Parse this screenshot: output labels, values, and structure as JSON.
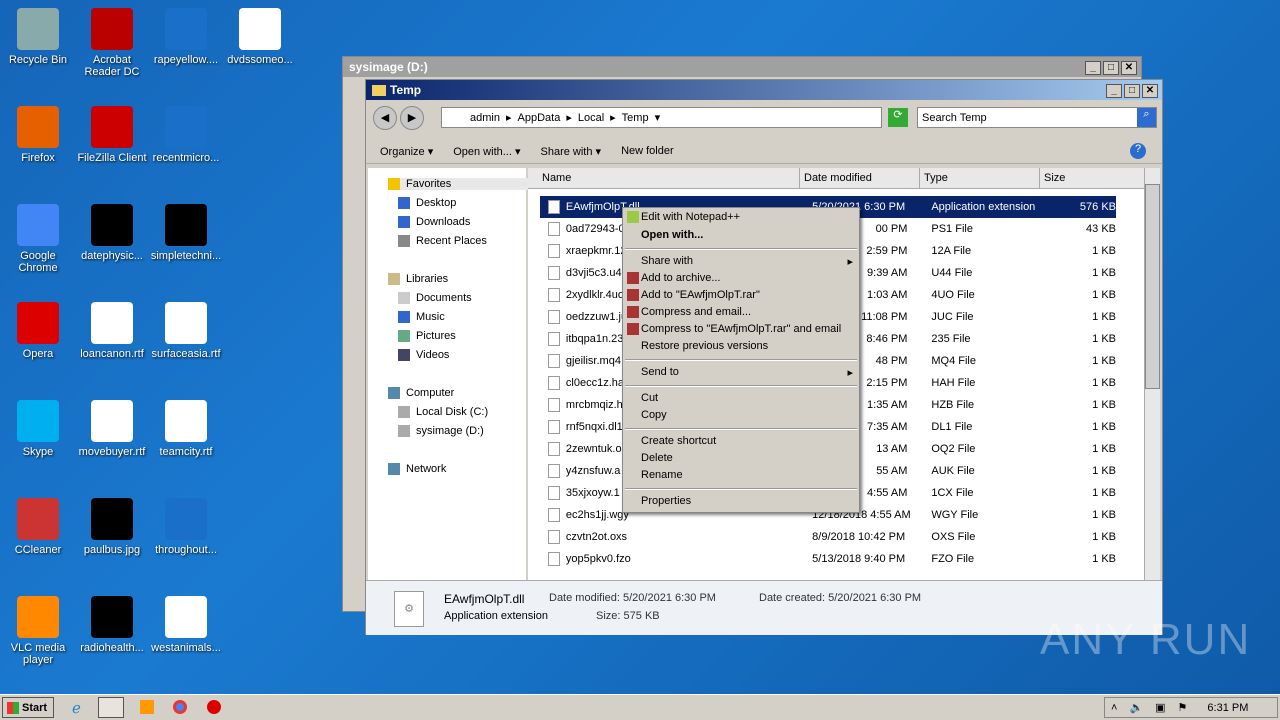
{
  "desktop": [
    {
      "label": "Recycle Bin",
      "color": "#8aa"
    },
    {
      "label": "Acrobat Reader DC",
      "color": "#b00"
    },
    {
      "label": "rapeyellow....",
      "color": "#1a6fc8"
    },
    {
      "label": "dvdssomeo...",
      "color": "#fff"
    },
    {
      "label": "Firefox",
      "color": "#e66000"
    },
    {
      "label": "FileZilla Client",
      "color": "#c00"
    },
    {
      "label": "recentmicro...",
      "color": "#1a6fc8"
    },
    {
      "label": "Google Chrome",
      "color": "#4285f4"
    },
    {
      "label": "datephysic...",
      "color": "#000"
    },
    {
      "label": "simpletechni...",
      "color": "#000"
    },
    {
      "label": "Opera",
      "color": "#d00"
    },
    {
      "label": "loancanon.rtf",
      "color": "#fff"
    },
    {
      "label": "surfaceasia.rtf",
      "color": "#fff"
    },
    {
      "label": "Skype",
      "color": "#00aff0"
    },
    {
      "label": "movebuyer.rtf",
      "color": "#fff"
    },
    {
      "label": "teamcity.rtf",
      "color": "#fff"
    },
    {
      "label": "CCleaner",
      "color": "#c33"
    },
    {
      "label": "paulbus.jpg",
      "color": "#000"
    },
    {
      "label": "throughout...",
      "color": "#1a6fc8"
    },
    {
      "label": "VLC media player",
      "color": "#f80"
    },
    {
      "label": "radiohealth...",
      "color": "#000"
    },
    {
      "label": "westanimals...",
      "color": "#fff"
    }
  ],
  "back_window": {
    "title": "sysimage (D:)"
  },
  "window": {
    "title": "Temp",
    "breadcrumb": [
      "admin",
      "AppData",
      "Local",
      "Temp"
    ],
    "search_placeholder": "Search Temp"
  },
  "toolbar": {
    "organize": "Organize",
    "open_with": "Open with...",
    "share_with": "Share with",
    "new_folder": "New folder"
  },
  "nav": {
    "favorites": "Favorites",
    "desktop": "Desktop",
    "downloads": "Downloads",
    "recent": "Recent Places",
    "libraries": "Libraries",
    "documents": "Documents",
    "music": "Music",
    "pictures": "Pictures",
    "videos": "Videos",
    "computer": "Computer",
    "local_disk": "Local Disk (C:)",
    "sysimage": "sysimage (D:)",
    "network": "Network"
  },
  "columns": {
    "name": "Name",
    "date": "Date modified",
    "type": "Type",
    "size": "Size"
  },
  "files": [
    {
      "name": "EAwfjmOlpT.dll",
      "date": "5/20/2021 6:30 PM",
      "type": "Application extension",
      "size": "576 KB"
    },
    {
      "name": "0ad72943-0",
      "date": "00 PM",
      "type": "PS1 File",
      "size": "43 KB"
    },
    {
      "name": "xraepkmr.12",
      "date": "2:59 PM",
      "type": "12A File",
      "size": "1 KB"
    },
    {
      "name": "d3vji5c3.u4",
      "date": "9:39 AM",
      "type": "U44 File",
      "size": "1 KB"
    },
    {
      "name": "2xydlklr.4uo",
      "date": "1:03 AM",
      "type": "4UO File",
      "size": "1 KB"
    },
    {
      "name": "oedzzuw1.ju",
      "date": "11:08 PM",
      "type": "JUC File",
      "size": "1 KB"
    },
    {
      "name": "itbqpa1n.23",
      "date": "8:46 PM",
      "type": "235 File",
      "size": "1 KB"
    },
    {
      "name": "gjeilisr.mq4",
      "date": "48 PM",
      "type": "MQ4 File",
      "size": "1 KB"
    },
    {
      "name": "cl0ecc1z.ha",
      "date": "2:15 PM",
      "type": "HAH File",
      "size": "1 KB"
    },
    {
      "name": "mrcbmqiz.hz",
      "date": "1:35 AM",
      "type": "HZB File",
      "size": "1 KB"
    },
    {
      "name": "rnf5nqxi.dl1",
      "date": "7:35 AM",
      "type": "DL1 File",
      "size": "1 KB"
    },
    {
      "name": "2zewntuk.o",
      "date": "13 AM",
      "type": "OQ2 File",
      "size": "1 KB"
    },
    {
      "name": "y4znsfuw.a",
      "date": "55 AM",
      "type": "AUK File",
      "size": "1 KB"
    },
    {
      "name": "35xjxoyw.1",
      "date": "4:55 AM",
      "type": "1CX File",
      "size": "1 KB"
    },
    {
      "name": "ec2hs1jj.wgy",
      "date": "12/18/2018 4:55 AM",
      "type": "WGY File",
      "size": "1 KB"
    },
    {
      "name": "czvtn2ot.oxs",
      "date": "8/9/2018 10:42 PM",
      "type": "OXS File",
      "size": "1 KB"
    },
    {
      "name": "yop5pkv0.fzo",
      "date": "5/13/2018 9:40 PM",
      "type": "FZO File",
      "size": "1 KB"
    }
  ],
  "menu": {
    "edit_npp": "Edit with Notepad++",
    "open_with": "Open with...",
    "share_with": "Share with",
    "add_archive": "Add to archive...",
    "add_rar": "Add to \"EAwfjmOlpT.rar\"",
    "compress_email": "Compress and email...",
    "compress_rar_email": "Compress to \"EAwfjmOlpT.rar\" and email",
    "restore": "Restore previous versions",
    "send_to": "Send to",
    "cut": "Cut",
    "copy": "Copy",
    "create_shortcut": "Create shortcut",
    "delete": "Delete",
    "rename": "Rename",
    "properties": "Properties"
  },
  "details": {
    "name": "EAwfjmOlpT.dll",
    "type": "Application extension",
    "modified_label": "Date modified:",
    "modified": "5/20/2021 6:30 PM",
    "created_label": "Date created:",
    "created": "5/20/2021 6:30 PM",
    "size_label": "Size:",
    "size": "575 KB"
  },
  "taskbar": {
    "start": "Start",
    "time": "6:31 PM"
  },
  "watermark": "ANY RUN"
}
